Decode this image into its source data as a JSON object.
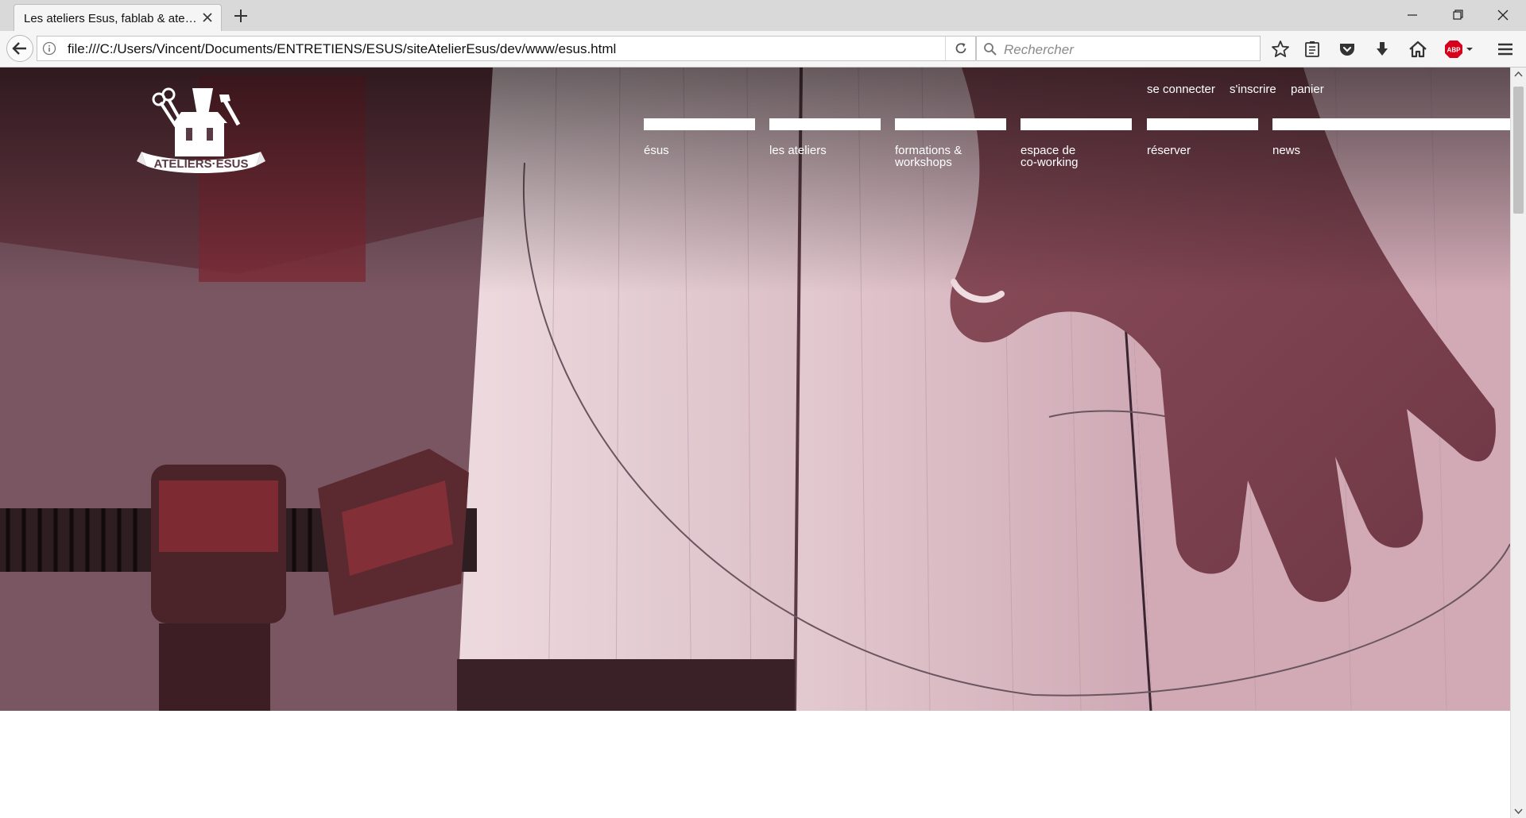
{
  "browser": {
    "tab_title": "Les ateliers Esus, fablab & ateliers partagés",
    "url": "file:///C:/Users/Vincent/Documents/ENTRETIENS/ESUS/siteAtelierEsus/dev/www/esus.html",
    "search_placeholder": "Rechercher",
    "toolbar_icons": [
      "star-icon",
      "reading-list-icon",
      "pocket-icon",
      "download-icon",
      "home-icon",
      "adblock-plus-icon",
      "menu-icon"
    ],
    "adblock_badge": "ABP"
  },
  "site": {
    "logo_text": "ATELIERS·ESUS",
    "top_links": [
      "se connecter",
      "s'inscrire",
      "panier"
    ],
    "menu": [
      {
        "label": "ésus"
      },
      {
        "label": "les ateliers"
      },
      {
        "label": "formations &\nworkshops"
      },
      {
        "label": "espace de\nco-working"
      },
      {
        "label": "réserver"
      },
      {
        "label": "news"
      }
    ]
  },
  "colors": {
    "hero_tint": "#6b4752",
    "wood": "#e8d2d8",
    "clamp_red": "#7a2830",
    "menu_bar": "#ffffff"
  }
}
